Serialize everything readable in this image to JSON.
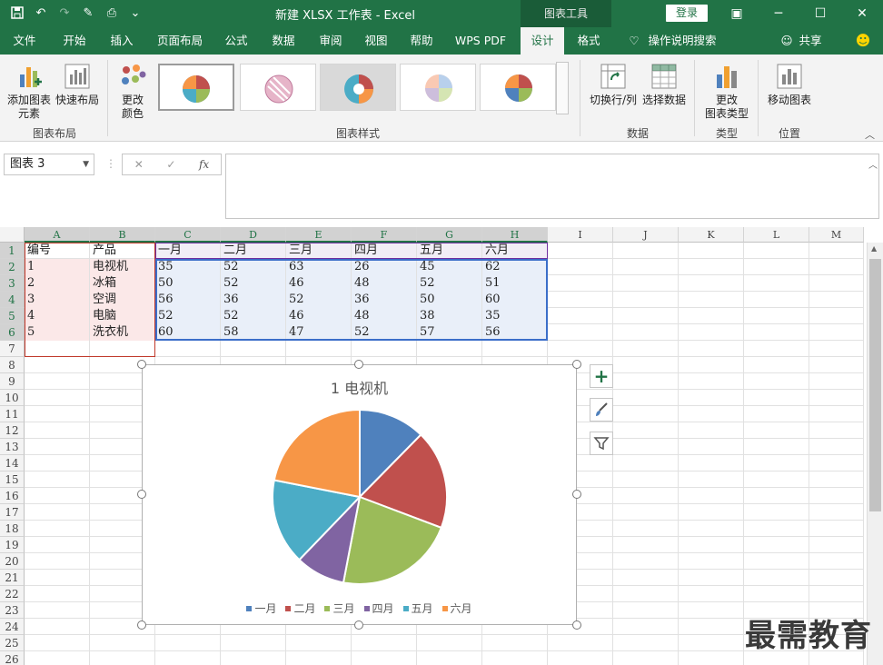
{
  "titlebar": {
    "document_title": "新建 XLSX 工作表  -  Excel",
    "context_tools": "图表工具",
    "login": "登录"
  },
  "tabs": [
    "文件",
    "开始",
    "插入",
    "页面布局",
    "公式",
    "数据",
    "审阅",
    "视图",
    "帮助",
    "WPS PDF",
    "设计",
    "格式"
  ],
  "active_tab": "设计",
  "tellme": "操作说明搜索",
  "share": "共享",
  "ribbon": {
    "add_element": "添加图表\n元素",
    "quick_layout": "快速布局",
    "change_colors": "更改\n颜色",
    "group_layout": "图表布局",
    "group_styles": "图表样式",
    "switch_rowcol": "切换行/列",
    "select_data": "选择数据",
    "group_data": "数据",
    "change_type": "更改\n图表类型",
    "group_type": "类型",
    "move_chart": "移动图表",
    "group_location": "位置"
  },
  "formulabar": {
    "namebox": "图表 3",
    "fx": "fx"
  },
  "sheet": {
    "columns": [
      "A",
      "B",
      "C",
      "D",
      "E",
      "F",
      "G",
      "H",
      "I",
      "J",
      "K",
      "L",
      "M"
    ],
    "rows": [
      "1",
      "2",
      "3",
      "4",
      "5",
      "6",
      "7",
      "8",
      "9",
      "10",
      "11",
      "12",
      "13",
      "14",
      "15",
      "16",
      "17",
      "18",
      "19",
      "20",
      "21",
      "22",
      "23",
      "24",
      "25",
      "26"
    ],
    "header": [
      "编号",
      "产品",
      "一月",
      "二月",
      "三月",
      "四月",
      "五月",
      "六月"
    ],
    "data": [
      [
        "1",
        "电视机",
        "35",
        "52",
        "63",
        "26",
        "45",
        "62"
      ],
      [
        "2",
        "冰箱",
        "50",
        "52",
        "46",
        "48",
        "52",
        "51"
      ],
      [
        "3",
        "空调",
        "56",
        "36",
        "52",
        "36",
        "50",
        "60"
      ],
      [
        "4",
        "电脑",
        "52",
        "52",
        "46",
        "48",
        "38",
        "35"
      ],
      [
        "5",
        "洗衣机",
        "60",
        "58",
        "47",
        "52",
        "57",
        "56"
      ]
    ]
  },
  "chart_data": {
    "type": "pie",
    "title": "1 电视机",
    "categories": [
      "一月",
      "二月",
      "三月",
      "四月",
      "五月",
      "六月"
    ],
    "values": [
      35,
      52,
      63,
      26,
      45,
      62
    ],
    "colors": [
      "#4f81bd",
      "#c0504d",
      "#9bbb59",
      "#8064a2",
      "#4bacc6",
      "#f79646"
    ],
    "legend": "bottom"
  },
  "watermark": "最需教育"
}
